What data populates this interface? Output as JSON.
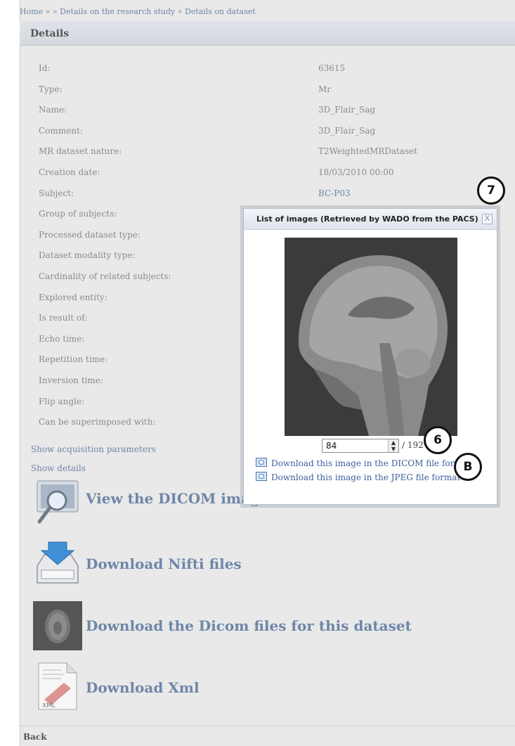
{
  "breadcrumb": {
    "home": "Home",
    "sep1": "»",
    "sep2": "»",
    "study": "Details on the research study",
    "sep3": "»",
    "current": "Details on dataset"
  },
  "details": {
    "title": "Details",
    "rows": [
      {
        "label": "Id:",
        "value": "63615"
      },
      {
        "label": "Type:",
        "value": "Mr"
      },
      {
        "label": "Name:",
        "value": "3D_Flair_Sag"
      },
      {
        "label": "Comment:",
        "value": "3D_Flair_Sag"
      },
      {
        "label": "MR dataset nature:",
        "value": "T2WeightedMRDataset"
      },
      {
        "label": "Creation date:",
        "value": "18/03/2010 00:00"
      },
      {
        "label": "Subject:",
        "value": "BC-P03"
      },
      {
        "label": "Group of subjects:",
        "value": ""
      },
      {
        "label": "Processed dataset type:",
        "value": ""
      },
      {
        "label": "Dataset modality type:",
        "value": ""
      },
      {
        "label": "Cardinality of related subjects:",
        "value": ""
      },
      {
        "label": "Explored entity:",
        "value": ""
      },
      {
        "label": "Is result of:",
        "value": ""
      },
      {
        "label": "Echo time:",
        "value": ""
      },
      {
        "label": "Repetition time:",
        "value": ""
      },
      {
        "label": "Inversion time:",
        "value": ""
      },
      {
        "label": "Flip angle:",
        "value": ""
      },
      {
        "label": "Can be superimposed with:",
        "value": ""
      }
    ],
    "show_acquisition": "Show acquisition parameters",
    "show_details": "Show details"
  },
  "actions": {
    "view_dicom": "View the DICOM images stored on the PACS Server",
    "download_nifti": "Download Nifti files",
    "download_dicom": "Download the Dicom files for this dataset",
    "download_xml": "Download Xml",
    "xml_icon_text": "XML"
  },
  "back": "Back",
  "modal": {
    "title": "List of images (Retrieved by WADO from the PACS)",
    "close": "X",
    "slice_value": "84",
    "slice_total": "/ 192",
    "dl_dicom": "Download this image in the DICOM file format",
    "dl_jpeg": "Download this image in the JPEG file format"
  },
  "callouts": {
    "c7": "7",
    "c6": "6",
    "cB": "B"
  },
  "icons": {
    "view": "magnifier-monitor-icon",
    "nifti": "download-tray-icon",
    "dicom": "brain-scan-icon",
    "xml": "xml-document-icon",
    "image": "image-icon"
  }
}
